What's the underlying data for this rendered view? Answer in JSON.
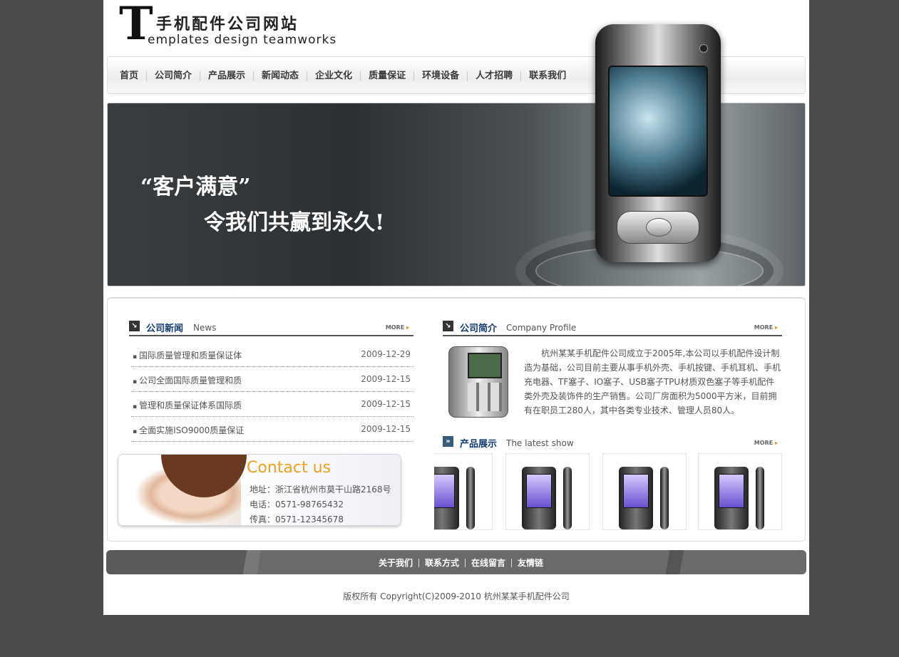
{
  "logo": {
    "big_letter": "T",
    "title_cn": "手机配件公司网站",
    "subtitle_en": "emplates design teamworks"
  },
  "nav": {
    "items": [
      "首页",
      "公司简介",
      "产品展示",
      "新闻动态",
      "企业文化",
      "质量保证",
      "环境设备",
      "人才招聘",
      "联系我们"
    ]
  },
  "banner": {
    "line1": "“客户满意”",
    "line2": "令我们共赢到永久!"
  },
  "news": {
    "title": "公司新闻",
    "title_en": "News",
    "more": "MORE",
    "items": [
      {
        "title": "国际质量管理和质量保证体",
        "date": "2009-12-29"
      },
      {
        "title": "公司全面国际质量管理和质",
        "date": "2009-12-15"
      },
      {
        "title": "管理和质量保证体系国际质",
        "date": "2009-12-15"
      },
      {
        "title": "全面实施ISO9000质量保证",
        "date": "2009-12-15"
      }
    ]
  },
  "contact": {
    "title": "Contact  us",
    "address": "地址：浙江省杭州市莫干山路2168号",
    "phone": "电话：0571-98765432",
    "fax": "传真：0571-12345678"
  },
  "about": {
    "title": "公司简介",
    "title_en": "Company Profile",
    "more": "MORE",
    "text": "杭州某某手机配件公司成立于2005年,本公司以手机配件设计制造为基础，公司目前主要从事手机外壳、手机按键、手机耳机、手机充电器、TF塞子、IO塞子、USB塞子TPU材质双色塞子等手机配件类外壳及装饰件的生产销售。公司厂房面积为5000平方米，目前拥有在职员工280人，其中各类专业技术、管理人员80人。"
  },
  "products": {
    "title": "产品展示",
    "title_en": "The latest show",
    "more": "MORE",
    "count_visible": 4
  },
  "footer": {
    "links": [
      "关于我们",
      "联系方式",
      "在线留言",
      "友情链"
    ],
    "copyright": "版权所有 Copyright(C)2009-2010 杭州某某手机配件公司"
  },
  "colors": {
    "background": "#4a4a4a",
    "heading_blue": "#123c6e",
    "contact_orange": "#f0a020"
  }
}
